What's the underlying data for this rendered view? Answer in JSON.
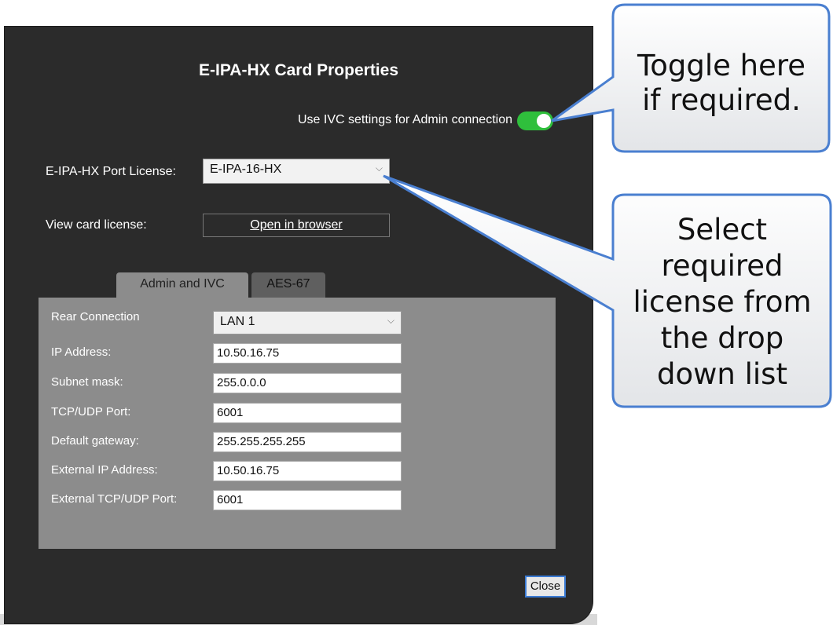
{
  "dialog": {
    "title": "E-IPA-HX Card Properties",
    "toggle_label": "Use IVC settings for Admin connection",
    "toggle_on": true,
    "port_license_label": "E-IPA-HX Port License:",
    "port_license_value": "E-IPA-16-HX",
    "view_license_label": "View card license:",
    "open_browser_label": "Open in browser",
    "tabs": [
      {
        "label": "Admin and IVC",
        "active": true
      },
      {
        "label": "AES-67",
        "active": false
      }
    ],
    "fields": {
      "rear_connection_label": "Rear Connection",
      "rear_connection_value": "LAN 1",
      "ip_label": "IP Address:",
      "ip_value": "10.50.16.75",
      "subnet_label": "Subnet mask:",
      "subnet_value": "255.0.0.0",
      "port_label": "TCP/UDP Port:",
      "port_value": "6001",
      "gateway_label": "Default gateway:",
      "gateway_value": "255.255.255.255",
      "ext_ip_label": "External IP Address:",
      "ext_ip_value": "10.50.16.75",
      "ext_port_label": "External TCP/UDP Port:",
      "ext_port_value": "6001"
    },
    "close_label": "Close"
  },
  "callouts": {
    "toggle_line1": "Toggle here",
    "toggle_line2": "if required.",
    "license_line1": "Select",
    "license_line2": "required",
    "license_line3": "license from",
    "license_line4": "the drop",
    "license_line5": "down list"
  },
  "colors": {
    "dialog_bg": "#2b2b2b",
    "panel_bg": "#8c8c8c",
    "toggle_on": "#2fbf3c",
    "callout_border": "#4a7fd0"
  },
  "icons": [
    "chevron-down-icon",
    "chevron-down-icon"
  ]
}
